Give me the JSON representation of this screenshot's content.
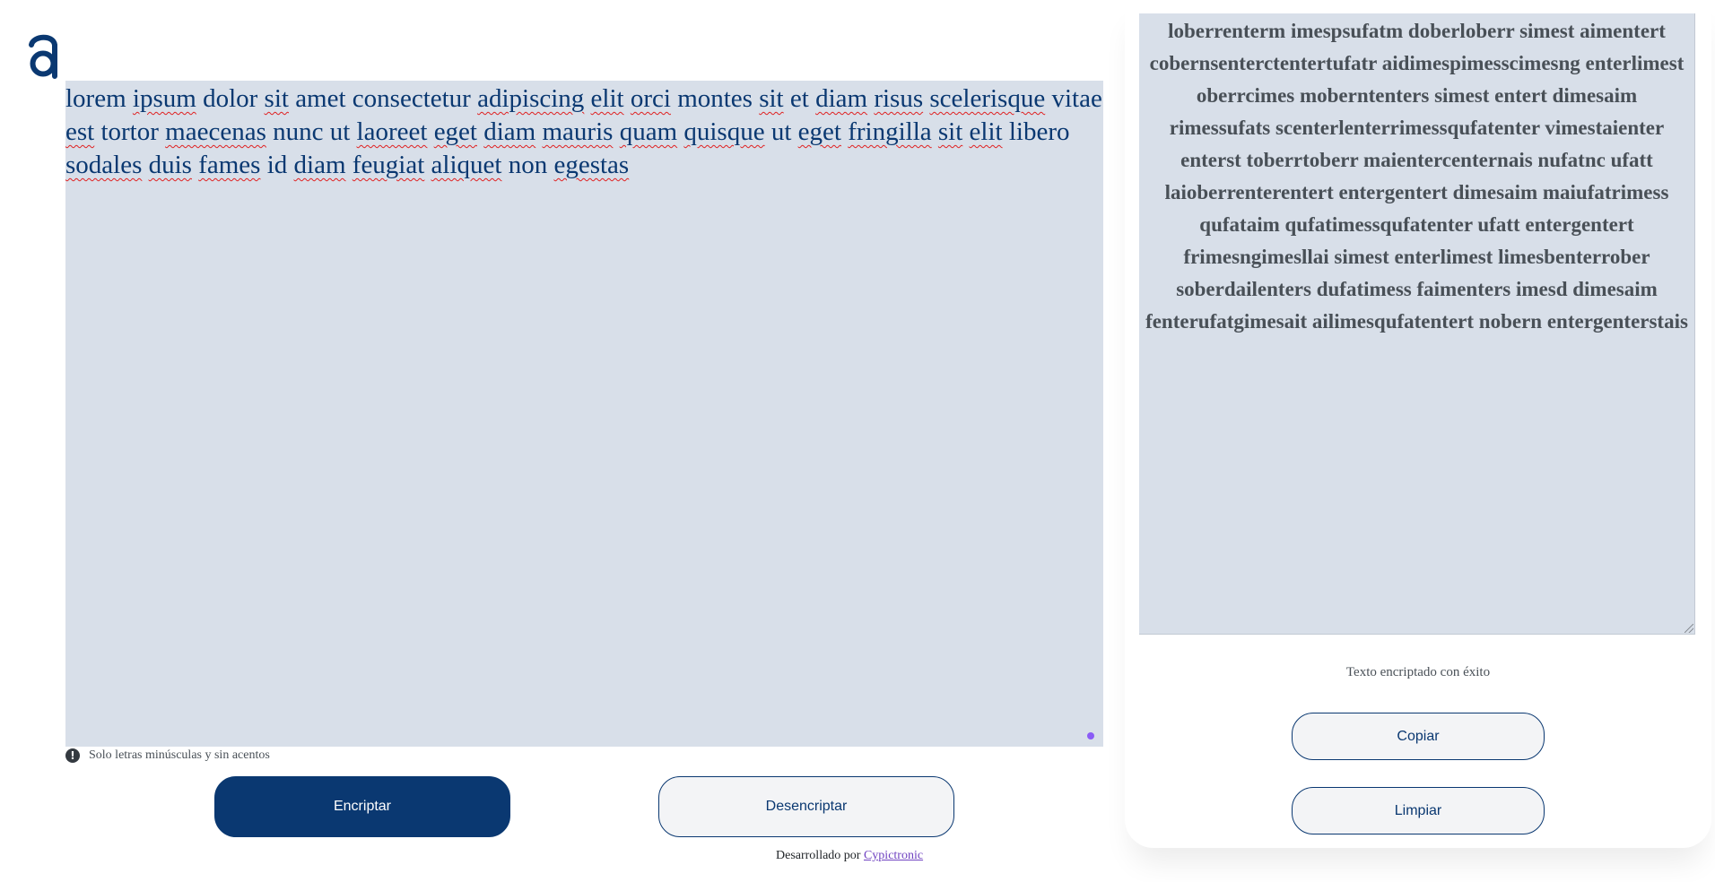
{
  "app": {
    "logo_icon": "brand-a-logo-icon",
    "accent_color": "#0a3871"
  },
  "input": {
    "text_words": [
      "lorem",
      "ipsum",
      "dolor",
      "sit",
      "amet",
      "consectetur",
      "adipiscing",
      "elit",
      "orci",
      "montes",
      "sit",
      "et",
      "diam",
      "risus",
      "scelerisque",
      "vitae",
      "est",
      "tortor",
      "maecenas",
      "nunc",
      "ut",
      "laoreet",
      "eget",
      "diam",
      "mauris",
      "quam",
      "quisque",
      "ut",
      "eget",
      "fringilla",
      "sit",
      "elit",
      "libero",
      "sodales",
      "duis",
      "fames",
      "id",
      "diam",
      "feugiat",
      "aliquet",
      "non",
      "egestas"
    ],
    "hint_icon": "exclamation-circle-icon",
    "hint": "Solo letras minúsculas y sin acentos"
  },
  "buttons": {
    "encrypt": "Encriptar",
    "decrypt": "Desencriptar"
  },
  "footer": {
    "prefix": "Desarrollado por",
    "link": "Cypictronic"
  },
  "output": {
    "text": "loberrenterm imespsufatm doberloberr simest aimentert cobernsenterctentertufatr aidimespimesscimesng enterlimest oberrcimes moberntenters simest entert dimesaim rimessufats scenterlenterrimessqufatenter vimestaienter enterst toberrtoberr maientercenternais nufatnc ufatt laioberrenterentert entergentert dimesaim maiufatrimess qufataim qufatimessqufatenter ufatt entergentert frimesngimesllai simest enterlimest limesbenterrober soberdailenters dufatimess faimenters imesd dimesaim fenterufatgimesait ailimesqufatentert nobern entergenterstais",
    "status": "Texto encriptado con éxito",
    "copy": "Copiar",
    "clear": "Limpiar"
  }
}
